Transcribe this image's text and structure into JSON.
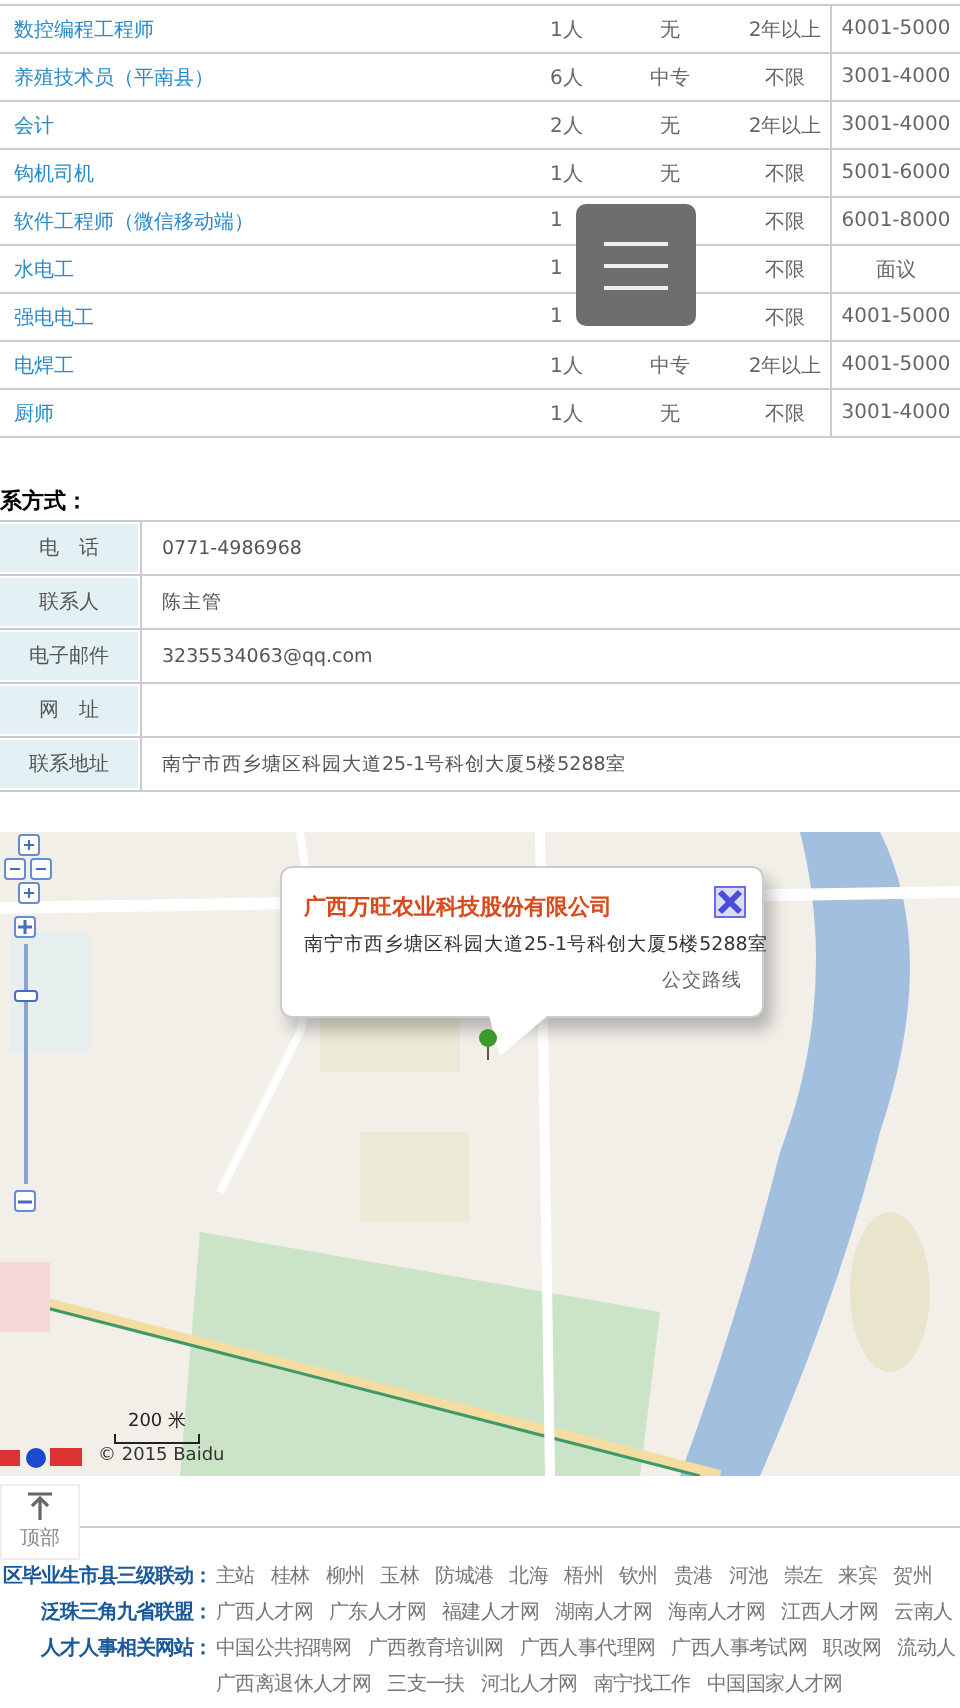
{
  "jobs": [
    {
      "title": "数控编程工程师",
      "count": "1人",
      "education": "无",
      "experience": "2年以上",
      "salary": "4001-5000"
    },
    {
      "title": "养殖技术员（平南县）",
      "count": "6人",
      "education": "中专",
      "experience": "不限",
      "salary": "3001-4000"
    },
    {
      "title": "会计",
      "count": "2人",
      "education": "无",
      "experience": "2年以上",
      "salary": "3001-4000"
    },
    {
      "title": "钩机司机",
      "count": "1人",
      "education": "无",
      "experience": "不限",
      "salary": "5001-6000"
    },
    {
      "title": "软件工程师（微信移动端）",
      "count": "1",
      "experience": "不限",
      "salary": "6001-8000"
    },
    {
      "title": "水电工",
      "count": "1",
      "experience": "不限",
      "salary": "面议"
    },
    {
      "title": "强电电工",
      "count": "1",
      "experience": "不限",
      "salary": "4001-5000"
    },
    {
      "title": "电焊工",
      "count": "1人",
      "education": "中专",
      "experience": "2年以上",
      "salary": "4001-5000"
    },
    {
      "title": "厨师",
      "count": "1人",
      "education": "无",
      "experience": "不限",
      "salary": "3001-4000"
    }
  ],
  "contact": {
    "heading": "系方式：",
    "rows": [
      {
        "label": "电　话",
        "value": "0771-4986968"
      },
      {
        "label": "联系人",
        "value": "陈主管"
      },
      {
        "label": "电子邮件",
        "value": "3235534063@qq.com"
      },
      {
        "label": "网　址"
      },
      {
        "label": "联系地址",
        "value": "南宁市西乡塘区科园大道25-1号科创大厦5楼5288室"
      }
    ]
  },
  "map": {
    "kind": "picture",
    "popup": {
      "title": "广西万旺农业科技股份有限公司",
      "address": "南宁市西乡塘区科园大道25-1号科创大厦5楼5288室",
      "link": "公交路线"
    },
    "zoom": {
      "level": 0.8
    },
    "scale": "200 米",
    "copyright": "© 2015 Baidu"
  },
  "back_to_top": "顶部",
  "footer": [
    {
      "label": "区毕业生市县三级联动：",
      "links": [
        "主站",
        "桂林",
        "柳州",
        "玉林",
        "防城港",
        "北海",
        "梧州",
        "钦州",
        "贵港",
        "河池",
        "崇左",
        "来宾",
        "贺州"
      ]
    },
    {
      "label": "泛珠三角九省联盟：",
      "links": [
        "广西人才网",
        "广东人才网",
        "福建人才网",
        "湖南人才网",
        "海南人才网",
        "江西人才网",
        "云南人"
      ]
    },
    {
      "label": "人才人事相关网站：",
      "links": [
        "中国公共招聘网",
        "广西教育培训网",
        "广西人事代理网",
        "广西人事考试网",
        "职改网",
        "流动人"
      ]
    },
    {
      "links": [
        "广西离退休人才网",
        "三支一扶",
        "河北人才网",
        "南宁找工作",
        "中国国家人才网"
      ]
    }
  ]
}
